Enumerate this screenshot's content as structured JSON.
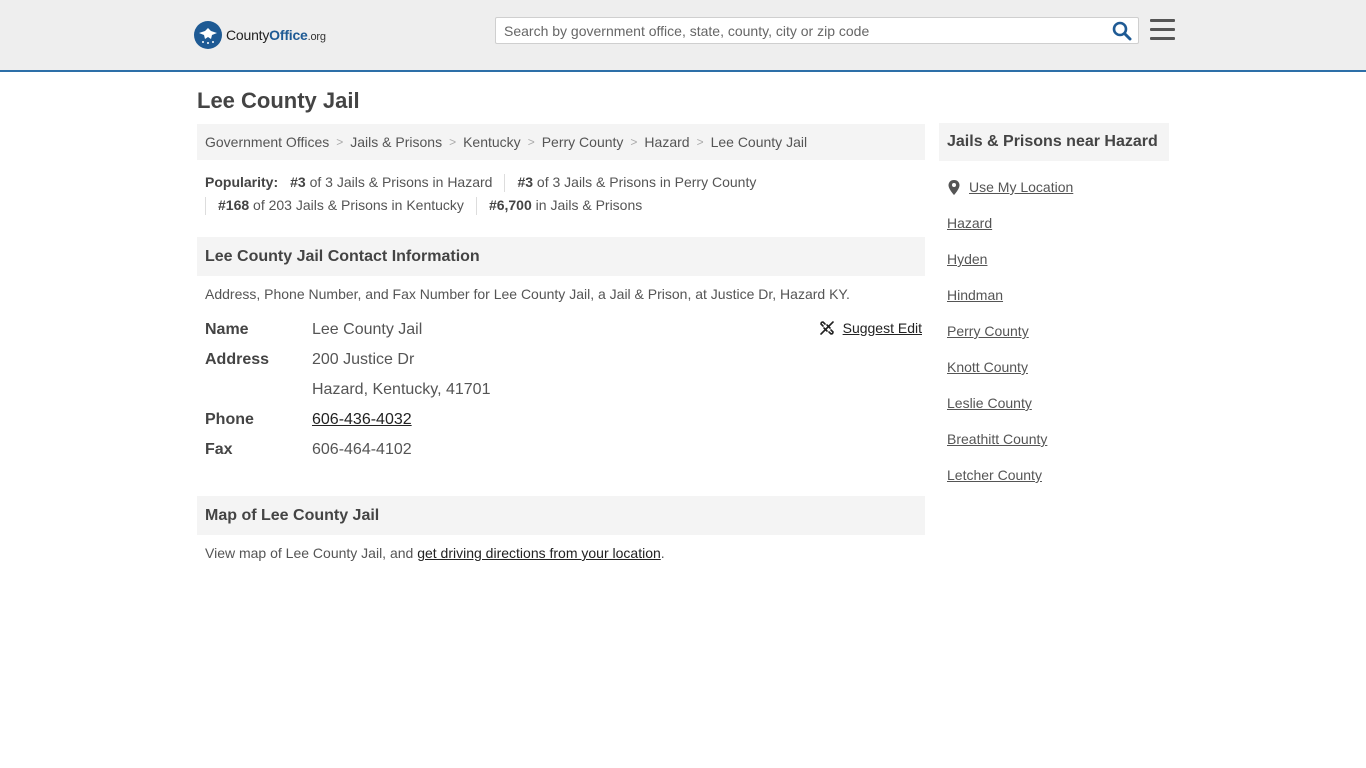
{
  "header": {
    "logo_main": "County",
    "logo_bold": "Office",
    "logo_tld": ".org",
    "search_placeholder": "Search by government office, state, county, city or zip code",
    "accent_color": "#2d6fa8"
  },
  "page": {
    "title": "Lee County Jail"
  },
  "breadcrumb": [
    "Government Offices",
    "Jails & Prisons",
    "Kentucky",
    "Perry County",
    "Hazard",
    "Lee County Jail"
  ],
  "popularity": {
    "label": "Popularity:",
    "items": [
      {
        "rank": "#3",
        "text": "of 3 Jails & Prisons in Hazard"
      },
      {
        "rank": "#3",
        "text": "of 3 Jails & Prisons in Perry County"
      },
      {
        "rank": "#168",
        "text": "of 203 Jails & Prisons in Kentucky"
      },
      {
        "rank": "#6,700",
        "text": "in Jails & Prisons"
      }
    ]
  },
  "contact": {
    "heading": "Lee County Jail Contact Information",
    "description": "Address, Phone Number, and Fax Number for Lee County Jail, a Jail & Prison, at Justice Dr, Hazard KY.",
    "suggest_edit": "Suggest Edit",
    "name_label": "Name",
    "name_value": "Lee County Jail",
    "address_label": "Address",
    "address_line1": "200 Justice Dr",
    "address_line2": "Hazard, Kentucky, 41701",
    "phone_label": "Phone",
    "phone_value": "606-436-4032",
    "fax_label": "Fax",
    "fax_value": "606-464-4102"
  },
  "map": {
    "heading": "Map of Lee County Jail",
    "text_before": "View map of Lee County Jail, and ",
    "link_text": "get driving directions from your location",
    "text_after": "."
  },
  "sidebar": {
    "heading": "Jails & Prisons near Hazard",
    "use_location": "Use My Location",
    "links": [
      "Hazard",
      "Hyden",
      "Hindman",
      "Perry County",
      "Knott County",
      "Leslie County",
      "Breathitt County",
      "Letcher County"
    ]
  }
}
